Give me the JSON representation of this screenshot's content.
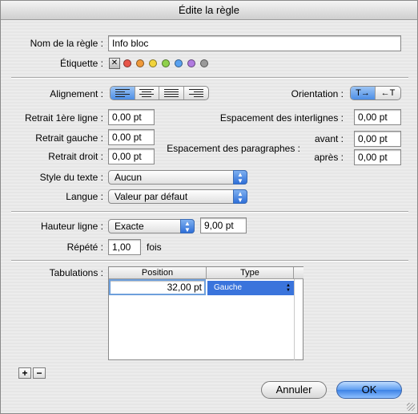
{
  "window": {
    "title": "Édite la règle"
  },
  "name_field": {
    "label": "Nom de la règle :",
    "value": "Info bloc"
  },
  "tag": {
    "label": "Étiquette :",
    "none_symbol": "✕",
    "colors": [
      "#e8564a",
      "#f09a3a",
      "#f2d43a",
      "#8fd14a",
      "#5aa2f0",
      "#b17be0",
      "#9a9a9a"
    ]
  },
  "alignment": {
    "label": "Alignement :",
    "options": [
      "left",
      "center",
      "justify",
      "right"
    ],
    "selected": "left"
  },
  "orientation": {
    "label": "Orientation :",
    "options": [
      "T→",
      "←T"
    ],
    "selected": "T→"
  },
  "indent_first": {
    "label": "Retrait 1ère ligne :",
    "value": "0,00 pt"
  },
  "indent_left": {
    "label": "Retrait gauche :",
    "value": "0,00 pt"
  },
  "indent_right": {
    "label": "Retrait droit :",
    "value": "0,00 pt"
  },
  "line_spacing": {
    "label": "Espacement des interlignes :",
    "value": "0,00 pt"
  },
  "para_spacing": {
    "label": "Espacement des paragraphes :",
    "before_label": "avant :",
    "before_value": "0,00 pt",
    "after_label": "après :",
    "after_value": "0,00 pt"
  },
  "text_style": {
    "label": "Style du texte :",
    "value": "Aucun"
  },
  "language": {
    "label": "Langue :",
    "value": "Valeur par défaut"
  },
  "line_height": {
    "label": "Hauteur ligne :",
    "mode": "Exacte",
    "value": "9,00 pt"
  },
  "repeat": {
    "label": "Répété :",
    "value": "1,00",
    "unit": "fois"
  },
  "tabs": {
    "label": "Tabulations :",
    "col_position": "Position",
    "col_type": "Type",
    "rows": [
      {
        "position": "32,00 pt",
        "type": "Gauche"
      }
    ]
  },
  "tab_controls": {
    "add": "+",
    "remove": "−"
  },
  "buttons": {
    "cancel": "Annuler",
    "ok": "OK"
  }
}
